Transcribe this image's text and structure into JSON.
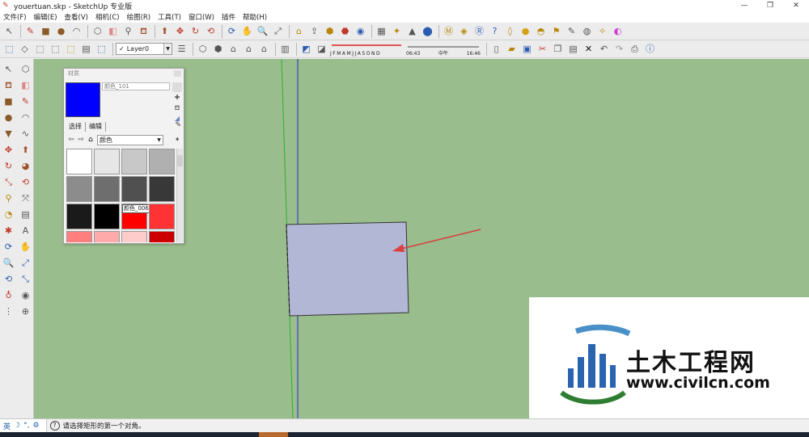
{
  "window": {
    "title": "youertuan.skp - SketchUp 专业版",
    "controls": [
      "—",
      "❐",
      "✕"
    ]
  },
  "menu": [
    "文件(F)",
    "编辑(E)",
    "查看(V)",
    "相机(C)",
    "绘图(R)",
    "工具(T)",
    "窗口(W)",
    "插件",
    "帮助(H)"
  ],
  "toolbar2": {
    "layer": "Layer0",
    "months": [
      "J",
      "F",
      "M",
      "A",
      "M",
      "J",
      "J",
      "A",
      "S",
      "O",
      "N",
      "D"
    ],
    "time_start": "06:43",
    "time_mid": "中午",
    "time_end": "16:46"
  },
  "materials_panel": {
    "title": "材质",
    "current_material": "颜色_101",
    "current_color": "#0000ff",
    "tabs": [
      "选择",
      "编辑"
    ],
    "collection": "颜色",
    "hover_tooltip": "颜色_006",
    "swatches": [
      "#ffffff",
      "#e6e6e6",
      "#c8c8c8",
      "#b0b0b0",
      "#8c8c8c",
      "#6e6e6e",
      "#505050",
      "#383838",
      "#1a1a1a",
      "#000000",
      "#ff0000",
      "#ff3333",
      "#ff7f7f",
      "#ffaaaa",
      "#ffcccc",
      "#cc0000"
    ]
  },
  "viewport": {
    "background": "#99bd8c",
    "rectangle_fill": "#b3b7d6"
  },
  "statusbar": {
    "ime": [
      "英",
      "☽",
      "°,",
      "⚙"
    ],
    "help": "?",
    "message": "请选择矩形的第一个对角。"
  },
  "watermark": {
    "name": "土木工程网",
    "url": "www.civilcn.com"
  }
}
